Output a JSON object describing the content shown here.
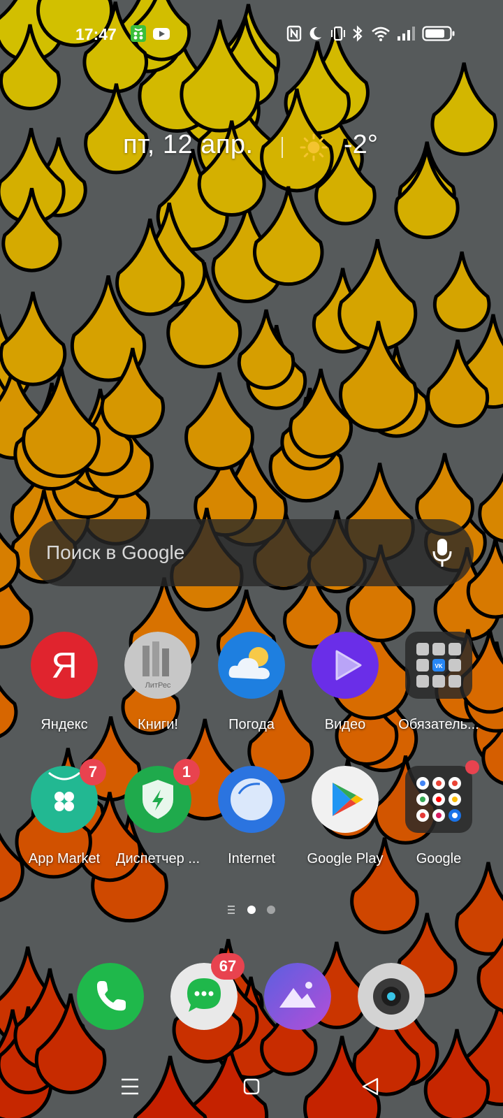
{
  "status_bar": {
    "time": "17:47",
    "notification_icons": [
      "shopping-bag-icon",
      "youtube-icon"
    ],
    "system_icons": [
      "nfc-icon",
      "moon-icon",
      "vibrate-icon",
      "bluetooth-icon",
      "wifi-icon",
      "signal-icon",
      "battery-icon"
    ]
  },
  "widget": {
    "date": "пт, 12 апр.",
    "weather_icon": "sun-icon",
    "temperature": "-2°"
  },
  "search": {
    "placeholder": "Поиск в Google",
    "icon": "mic-icon"
  },
  "apps_row1": [
    {
      "label": "Яндекс",
      "icon": "yandex-icon",
      "icon_text": "Я"
    },
    {
      "label": "Книги!",
      "icon": "litres-icon",
      "icon_text": "ЛитРес"
    },
    {
      "label": "Погода",
      "icon": "weather-icon"
    },
    {
      "label": "Видео",
      "icon": "video-icon"
    },
    {
      "label": "Обязатель...",
      "icon": "folder-icon"
    }
  ],
  "apps_row2": [
    {
      "label": "App Market",
      "icon": "app-market-icon",
      "badge": "7"
    },
    {
      "label": "Диспетчер ...",
      "icon": "phone-manager-icon",
      "badge": "1"
    },
    {
      "label": "Internet",
      "icon": "browser-icon"
    },
    {
      "label": "Google Play",
      "icon": "google-play-icon"
    },
    {
      "label": "Google",
      "icon": "google-folder-icon",
      "badge": ""
    }
  ],
  "pager": {
    "pages": 2,
    "current": 1
  },
  "dock": [
    {
      "icon": "phone-icon"
    },
    {
      "icon": "messages-icon",
      "badge": "67"
    },
    {
      "icon": "gallery-icon"
    },
    {
      "icon": "camera-icon"
    }
  ],
  "nav": [
    "menu-icon",
    "home-icon",
    "back-icon"
  ],
  "colors": {
    "background": "#565a5b",
    "badge": "#e8434f",
    "drop_yellow": "#cfc000",
    "drop_orange": "#d87000",
    "drop_red": "#c82800"
  }
}
